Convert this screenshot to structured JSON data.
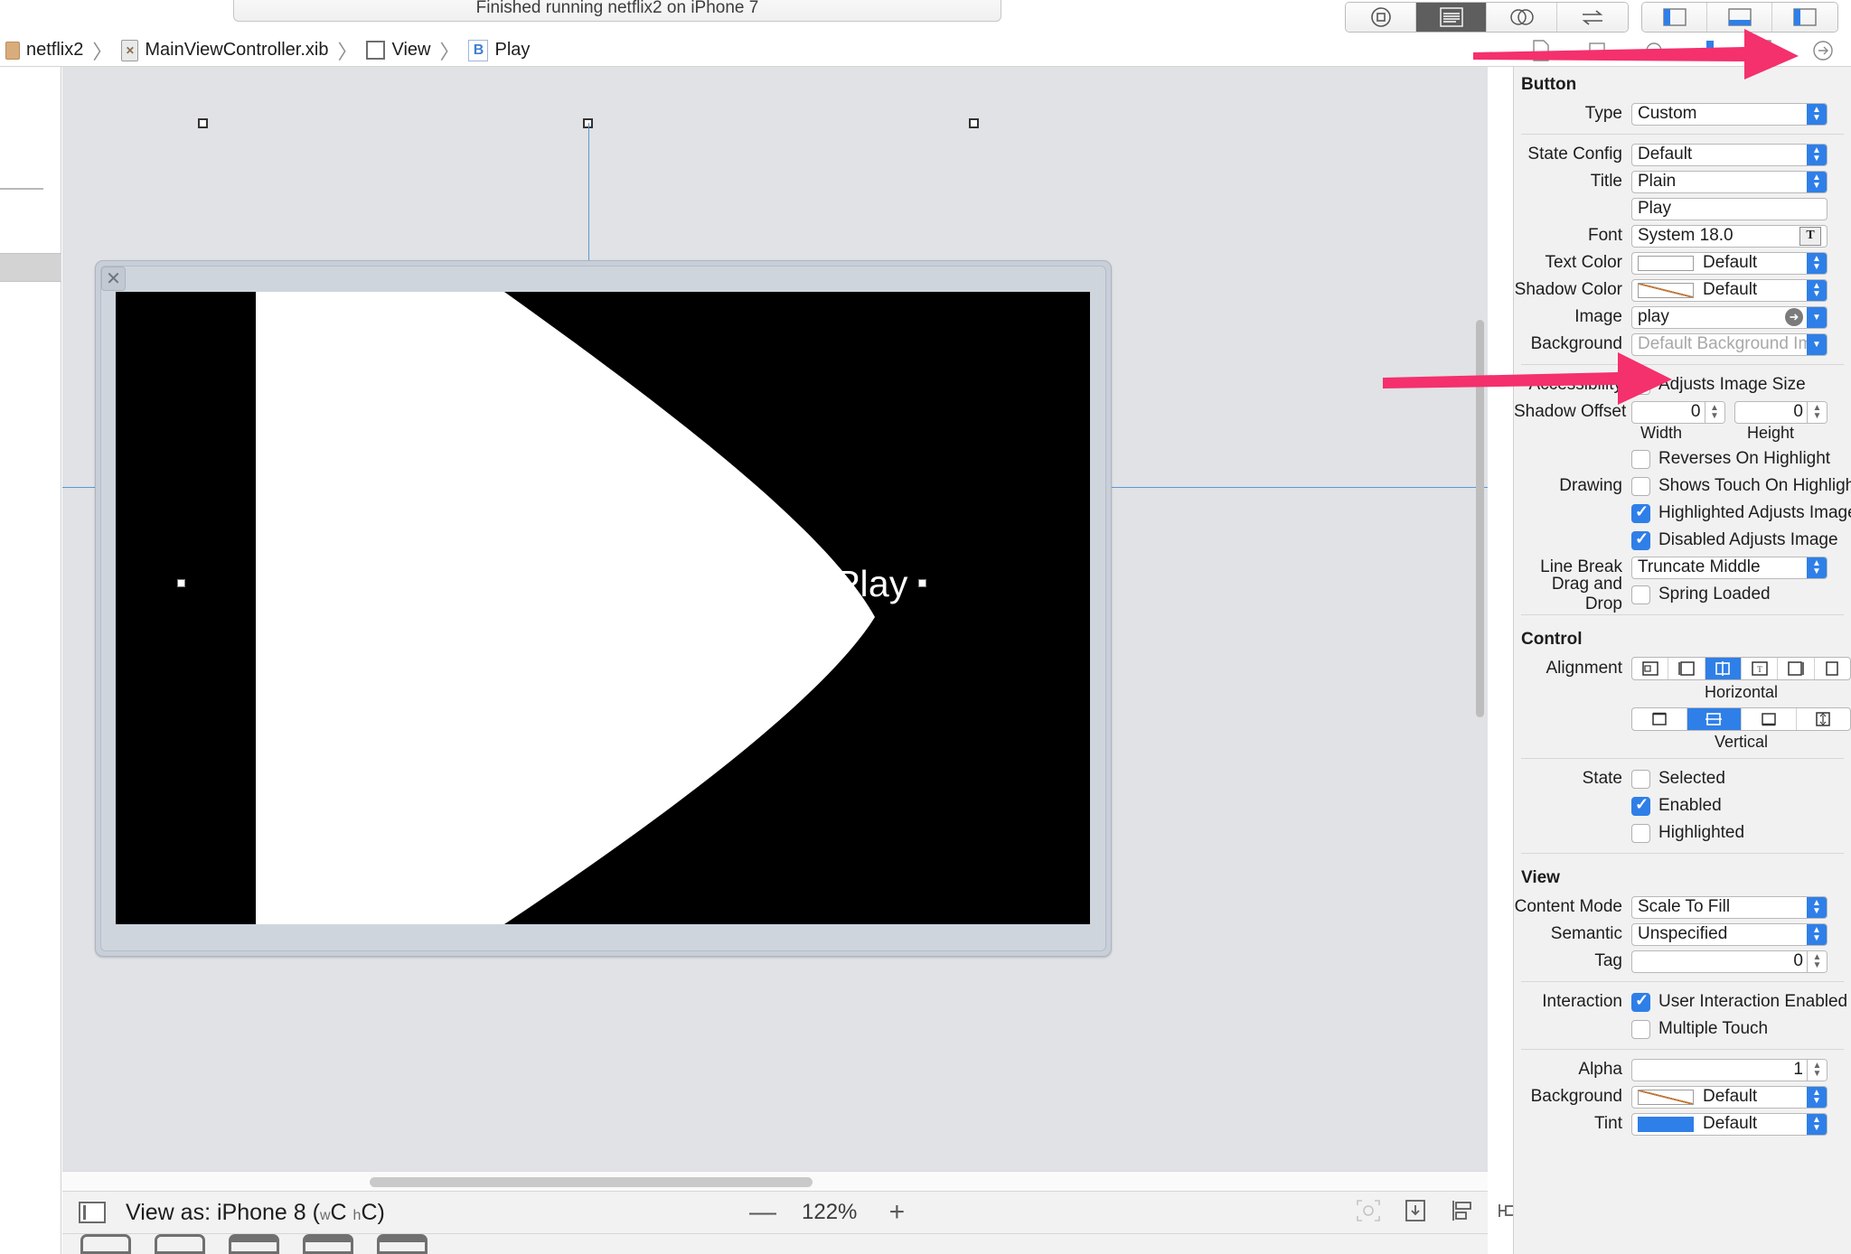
{
  "toolbar": {
    "status_text": "Finished running netflix2 on iPhone 7",
    "icons": [
      "stop-icon",
      "standard-editor-icon",
      "assistant-editor-icon",
      "version-editor-icon",
      "navigator-panel-icon",
      "debug-panel-icon",
      "utilities-panel-icon"
    ]
  },
  "breadcrumb": {
    "items": [
      {
        "label": "netflix2",
        "icon": "project-folder-icon"
      },
      {
        "label": "MainViewController.xib",
        "icon": "xib-file-icon"
      },
      {
        "label": "View",
        "icon": "view-square-icon"
      },
      {
        "label": "Play",
        "icon": "button-b-icon"
      }
    ],
    "separator": "〉"
  },
  "inspector_tabs": [
    {
      "name": "file-inspector-icon",
      "selected": false
    },
    {
      "name": "quick-help-icon",
      "selected": false
    },
    {
      "name": "identity-inspector-icon",
      "selected": false
    },
    {
      "name": "attributes-inspector-icon",
      "selected": true
    },
    {
      "name": "size-inspector-icon",
      "selected": false
    },
    {
      "name": "connections-inspector-icon",
      "selected": false
    }
  ],
  "canvas": {
    "play_label": "Play",
    "close_glyph": "✕"
  },
  "inspector": {
    "button_section": {
      "title": "Button",
      "type": {
        "label": "Type",
        "value": "Custom"
      },
      "state_config": {
        "label": "State Config",
        "value": "Default"
      },
      "title_style": {
        "label": "Title",
        "value": "Plain"
      },
      "title_text": {
        "value": "Play"
      },
      "font": {
        "label": "Font",
        "value": "System 18.0"
      },
      "text_color": {
        "label": "Text Color",
        "value": "Default"
      },
      "shadow_color": {
        "label": "Shadow Color",
        "value": "Default"
      },
      "image": {
        "label": "Image",
        "value": "play"
      },
      "background": {
        "label": "Background",
        "placeholder": "Default Background Imag"
      },
      "accessibility": {
        "label": "Accessibility",
        "checkbox": "Adjusts Image Size",
        "checked": false
      },
      "shadow_offset": {
        "label": "Shadow Offset",
        "width": "0",
        "height": "0",
        "width_caption": "Width",
        "height_caption": "Height"
      },
      "drawing": {
        "label": "Drawing",
        "options": [
          {
            "label": "Reverses On Highlight",
            "checked": false
          },
          {
            "label": "Shows Touch On Highlight",
            "checked": false
          },
          {
            "label": "Highlighted Adjusts Image",
            "checked": true
          },
          {
            "label": "Disabled Adjusts Image",
            "checked": true
          }
        ]
      },
      "line_break": {
        "label": "Line Break",
        "value": "Truncate Middle"
      },
      "drag_and_drop": {
        "label": "Drag and Drop",
        "checkbox": "Spring Loaded",
        "checked": false
      }
    },
    "control_section": {
      "title": "Control",
      "alignment": {
        "label": "Alignment"
      },
      "horizontal_caption": "Horizontal",
      "vertical_caption": "Vertical",
      "horizontal_selected_index": 2,
      "vertical_selected_index": 1,
      "state": {
        "label": "State",
        "options": [
          {
            "label": "Selected",
            "checked": false
          },
          {
            "label": "Enabled",
            "checked": true
          },
          {
            "label": "Highlighted",
            "checked": false
          }
        ]
      }
    },
    "view_section": {
      "title": "View",
      "content_mode": {
        "label": "Content Mode",
        "value": "Scale To Fill"
      },
      "semantic": {
        "label": "Semantic",
        "value": "Unspecified"
      },
      "tag": {
        "label": "Tag",
        "value": "0"
      },
      "interaction": {
        "label": "Interaction",
        "options": [
          {
            "label": "User Interaction Enabled",
            "checked": true
          },
          {
            "label": "Multiple Touch",
            "checked": false
          }
        ]
      },
      "alpha": {
        "label": "Alpha",
        "value": "1"
      },
      "background": {
        "label": "Background",
        "value": "Default"
      },
      "tint": {
        "label": "Tint",
        "value": "Default"
      }
    }
  },
  "bottom_bar": {
    "view_as": "View as: iPhone 8 (",
    "size_class_w": "w",
    "size_class_wc": "C",
    "size_class_h": "h",
    "size_class_hc": "C)",
    "zoom_out": "—",
    "zoom_value": "122%",
    "zoom_in": "+",
    "autolayout_icons": [
      "update-frames-icon",
      "embed-in-icon",
      "align-icon",
      "add-constraints-icon",
      "resolve-issues-icon"
    ],
    "add_icon": "+"
  },
  "colors": {
    "accent_blue": "#2f7fe8",
    "annotation_pink": "#f4306d",
    "panel_bg": "#f1f1f1",
    "canvas_bg": "#e0e2e5"
  }
}
